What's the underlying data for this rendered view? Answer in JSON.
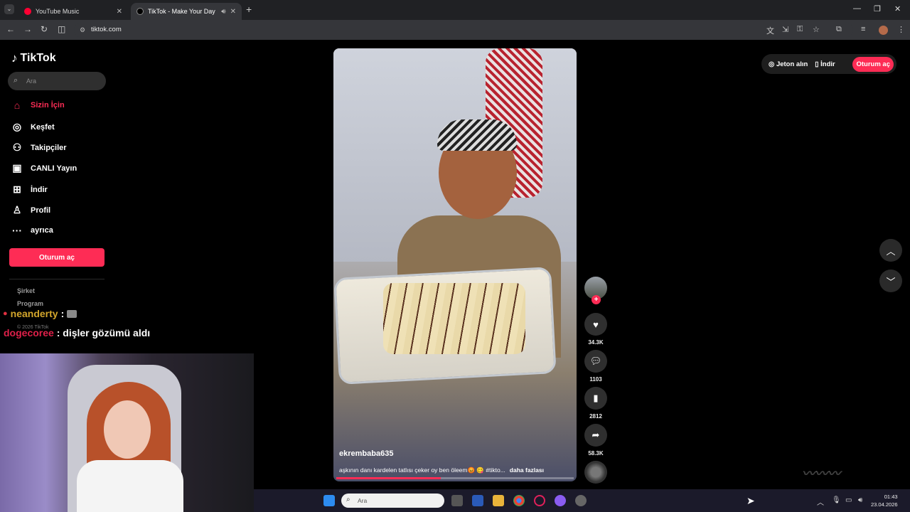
{
  "browser": {
    "tabs": [
      {
        "title": "YouTube Music",
        "active": false,
        "favicon_color": "#ff0033"
      },
      {
        "title": "TikTok - Make Your Day",
        "active": true,
        "favicon_color": "#000000"
      }
    ],
    "url": "tiktok.com"
  },
  "sidebar": {
    "logo_text": "TikTok",
    "search_placeholder": "Ara",
    "nav_items": [
      {
        "label": "Sizin İçin",
        "icon": "home-icon",
        "active": true
      },
      {
        "label": "Keşfet",
        "icon": "compass-icon",
        "active": false
      },
      {
        "label": "Takipçiler",
        "icon": "followers-icon",
        "active": false
      },
      {
        "label": "CANLI Yayın",
        "icon": "live-icon",
        "active": false
      },
      {
        "label": "İndir",
        "icon": "download-icon",
        "active": false
      },
      {
        "label": "Profil",
        "icon": "profile-icon",
        "active": false
      },
      {
        "label": "ayrıca",
        "icon": "more-icon",
        "active": false
      }
    ],
    "login_button": "Oturum aç",
    "footer_links": [
      "Şirket",
      "Program"
    ],
    "copyright": "© 2026 TikTok"
  },
  "chat": [
    {
      "user": "neanderty",
      "message": ""
    },
    {
      "user": "dogecoree",
      "message": "dişler gözümü aldı"
    }
  ],
  "video": {
    "username": "ekrembaba635",
    "caption": "aşkının danı kardelen tatlısı çeker oy ben öleem😡 😋 #tikto...",
    "more_label": "daha fazlası",
    "progress": 0.44
  },
  "actions": {
    "likes": "34.3K",
    "comments": "1103",
    "saves": "2812",
    "shares": "58.3K"
  },
  "topbar": {
    "coins_label": "Jeton alın",
    "download_label": "İndir",
    "login_label": "Oturum aç"
  },
  "taskbar": {
    "search_placeholder": "Ara",
    "time": "01:43",
    "date": "23.04.2026"
  },
  "colors": {
    "accent": "#fe2c55",
    "chat_user1": "#d4a72c",
    "chat_user2": "#e0204a"
  }
}
